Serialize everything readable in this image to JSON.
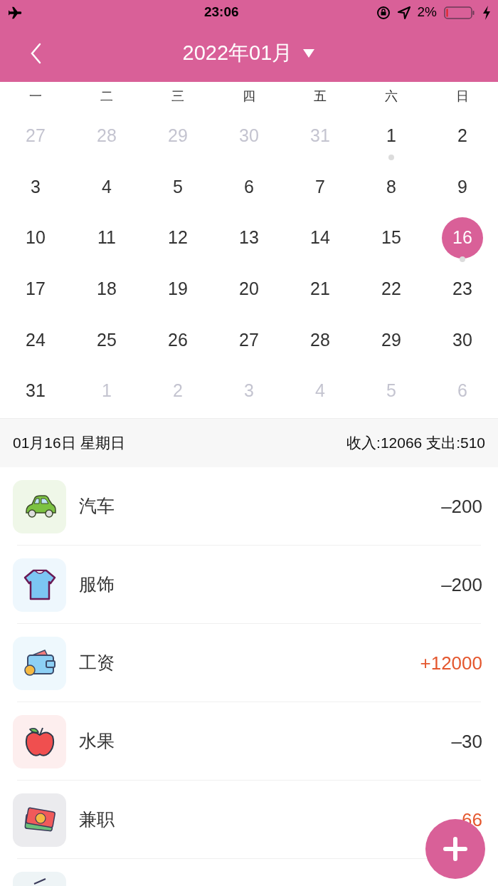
{
  "status_bar": {
    "time": "23:06",
    "battery": "2%"
  },
  "header": {
    "title": "2022年01月"
  },
  "calendar": {
    "weekdays": [
      "一",
      "二",
      "三",
      "四",
      "五",
      "六",
      "日"
    ],
    "days": [
      {
        "label": "27",
        "in_month": false,
        "selected": false,
        "has_record": false
      },
      {
        "label": "28",
        "in_month": false,
        "selected": false,
        "has_record": false
      },
      {
        "label": "29",
        "in_month": false,
        "selected": false,
        "has_record": false
      },
      {
        "label": "30",
        "in_month": false,
        "selected": false,
        "has_record": false
      },
      {
        "label": "31",
        "in_month": false,
        "selected": false,
        "has_record": false
      },
      {
        "label": "1",
        "in_month": true,
        "selected": false,
        "has_record": true
      },
      {
        "label": "2",
        "in_month": true,
        "selected": false,
        "has_record": false
      },
      {
        "label": "3",
        "in_month": true,
        "selected": false,
        "has_record": false
      },
      {
        "label": "4",
        "in_month": true,
        "selected": false,
        "has_record": false
      },
      {
        "label": "5",
        "in_month": true,
        "selected": false,
        "has_record": false
      },
      {
        "label": "6",
        "in_month": true,
        "selected": false,
        "has_record": false
      },
      {
        "label": "7",
        "in_month": true,
        "selected": false,
        "has_record": false
      },
      {
        "label": "8",
        "in_month": true,
        "selected": false,
        "has_record": false
      },
      {
        "label": "9",
        "in_month": true,
        "selected": false,
        "has_record": false
      },
      {
        "label": "10",
        "in_month": true,
        "selected": false,
        "has_record": false
      },
      {
        "label": "11",
        "in_month": true,
        "selected": false,
        "has_record": false
      },
      {
        "label": "12",
        "in_month": true,
        "selected": false,
        "has_record": false
      },
      {
        "label": "13",
        "in_month": true,
        "selected": false,
        "has_record": false
      },
      {
        "label": "14",
        "in_month": true,
        "selected": false,
        "has_record": false
      },
      {
        "label": "15",
        "in_month": true,
        "selected": false,
        "has_record": false
      },
      {
        "label": "16",
        "in_month": true,
        "selected": true,
        "has_record": true
      },
      {
        "label": "17",
        "in_month": true,
        "selected": false,
        "has_record": false
      },
      {
        "label": "18",
        "in_month": true,
        "selected": false,
        "has_record": false
      },
      {
        "label": "19",
        "in_month": true,
        "selected": false,
        "has_record": false
      },
      {
        "label": "20",
        "in_month": true,
        "selected": false,
        "has_record": false
      },
      {
        "label": "21",
        "in_month": true,
        "selected": false,
        "has_record": false
      },
      {
        "label": "22",
        "in_month": true,
        "selected": false,
        "has_record": false
      },
      {
        "label": "23",
        "in_month": true,
        "selected": false,
        "has_record": false
      },
      {
        "label": "24",
        "in_month": true,
        "selected": false,
        "has_record": false
      },
      {
        "label": "25",
        "in_month": true,
        "selected": false,
        "has_record": false
      },
      {
        "label": "26",
        "in_month": true,
        "selected": false,
        "has_record": false
      },
      {
        "label": "27",
        "in_month": true,
        "selected": false,
        "has_record": false
      },
      {
        "label": "28",
        "in_month": true,
        "selected": false,
        "has_record": false
      },
      {
        "label": "29",
        "in_month": true,
        "selected": false,
        "has_record": false
      },
      {
        "label": "30",
        "in_month": true,
        "selected": false,
        "has_record": false
      },
      {
        "label": "31",
        "in_month": true,
        "selected": false,
        "has_record": false
      },
      {
        "label": "1",
        "in_month": false,
        "selected": false,
        "has_record": false
      },
      {
        "label": "2",
        "in_month": false,
        "selected": false,
        "has_record": false
      },
      {
        "label": "3",
        "in_month": false,
        "selected": false,
        "has_record": false
      },
      {
        "label": "4",
        "in_month": false,
        "selected": false,
        "has_record": false
      },
      {
        "label": "5",
        "in_month": false,
        "selected": false,
        "has_record": false
      },
      {
        "label": "6",
        "in_month": false,
        "selected": false,
        "has_record": false
      }
    ]
  },
  "summary": {
    "date": "01月16日 星期日",
    "totals": "收入:12066 支出:510"
  },
  "records": [
    {
      "kind": "car",
      "color": "#eff7e8",
      "name": "汽车",
      "amount": "–200",
      "income": false
    },
    {
      "kind": "shirt",
      "color": "#eef7fd",
      "name": "服饰",
      "amount": "–200",
      "income": false
    },
    {
      "kind": "wallet",
      "color": "#eef8fd",
      "name": "工资",
      "amount": "+12000",
      "income": true
    },
    {
      "kind": "apple",
      "color": "#fdeeee",
      "name": "水果",
      "amount": "–30",
      "income": false
    },
    {
      "kind": "cash",
      "color": "#ebebee",
      "name": "兼职",
      "amount": "66",
      "income": true
    },
    {
      "kind": "pen",
      "color": "#eef4f6"
    }
  ]
}
